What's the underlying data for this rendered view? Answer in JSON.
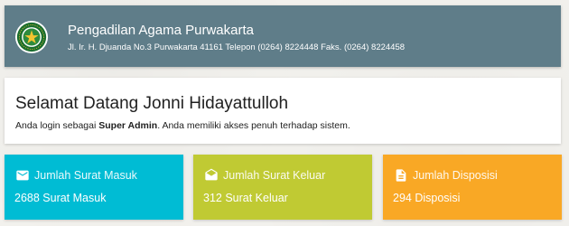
{
  "header": {
    "court_name": "Pengadilan Agama Purwakarta",
    "address": "Jl. Ir. H. Djuanda No.3 Purwakarta 41161 Telepon (0264) 8224448 Faks. (0264) 8224458",
    "logo_icon": "court-seal-icon",
    "background_color": "#5f7d89"
  },
  "welcome": {
    "title": "Selamat Datang Jonni Hidayattulloh",
    "text_before": "Anda login sebagai ",
    "role": "Super Admin",
    "text_after": ". Anda memiliki akses penuh terhadap sistem."
  },
  "cards": [
    {
      "title": "Jumlah Surat Masuk",
      "value": "2688 Surat Masuk",
      "icon": "mail-icon",
      "color": "#00bcd4"
    },
    {
      "title": "Jumlah Surat Keluar",
      "value": "312 Surat Keluar",
      "icon": "mail-open-icon",
      "color": "#c0ca33"
    },
    {
      "title": "Jumlah Disposisi",
      "value": "294 Disposisi",
      "icon": "document-icon",
      "color": "#f9a825"
    }
  ]
}
